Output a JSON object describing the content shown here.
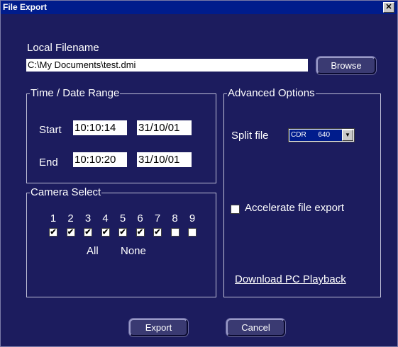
{
  "window": {
    "title": "File Export",
    "close_glyph": "✕"
  },
  "local_filename": {
    "label": "Local Filename",
    "value": "C:\\My Documents\\test.dmi",
    "browse_label": "Browse"
  },
  "time_range": {
    "title": "Time / Date Range",
    "start_label": "Start",
    "start_time": "10:10:14",
    "start_date": "31/10/01",
    "end_label": "End",
    "end_time": "10:10:20",
    "end_date": "31/10/01"
  },
  "camera_select": {
    "title": "Camera Select",
    "cameras": [
      {
        "num": "1",
        "checked": true
      },
      {
        "num": "2",
        "checked": true
      },
      {
        "num": "3",
        "checked": true
      },
      {
        "num": "4",
        "checked": true
      },
      {
        "num": "5",
        "checked": true
      },
      {
        "num": "6",
        "checked": true
      },
      {
        "num": "7",
        "checked": true
      },
      {
        "num": "8",
        "checked": false
      },
      {
        "num": "9",
        "checked": false
      }
    ],
    "all_label": "All",
    "none_label": "None"
  },
  "advanced": {
    "title": "Advanced Options",
    "split_label": "Split file",
    "split_value": "CDR      640",
    "accelerate_label": "Accelerate file export",
    "accelerate_checked": false,
    "download_link": "Download PC Playback"
  },
  "buttons": {
    "export_label": "Export",
    "cancel_label": "Cancel"
  },
  "colors": {
    "background": "#1c1c5e",
    "titlebar": "#001c8c",
    "text": "#ffffff"
  }
}
